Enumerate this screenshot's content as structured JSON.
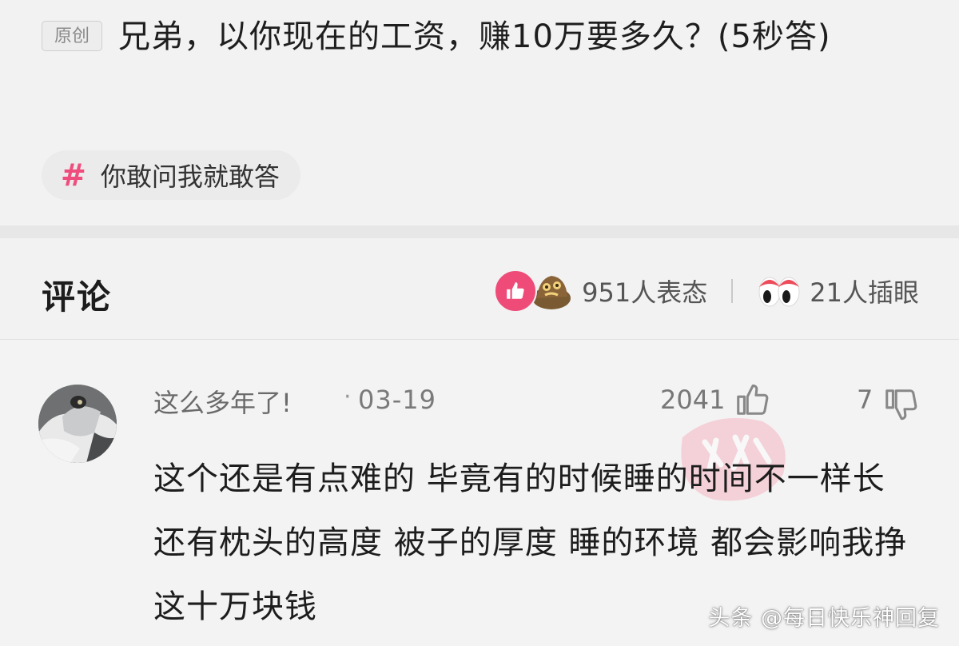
{
  "post": {
    "badge": "原创",
    "title": "兄弟，以你现在的工资，赚10万要多久？(5秒答)",
    "topic": "你敢问我就敢答"
  },
  "comments_header": {
    "title": "评论",
    "reactions_label": "951人表态",
    "eyes_label": "21人插眼"
  },
  "comment": {
    "username": "这么多年了!",
    "dot": "·",
    "date": "03-19",
    "likes": "2041",
    "dislikes": "7",
    "text": "这个还是有点难的 毕竟有的时候睡的时间不一样长 还有枕头的高度 被子的厚度 睡的环境 都会影响我挣这十万块钱"
  },
  "watermark": "头条 @每日快乐神回复",
  "colors": {
    "accent_pink": "#ee4b78",
    "background": "#f2f2f2",
    "text_primary": "#1e1e1e",
    "text_secondary": "#777777"
  },
  "icons": [
    "hash-icon",
    "like-reaction-icon",
    "dog-emoji-icon",
    "eyes-emoji-icon",
    "thumb-up-icon",
    "thumb-down-icon"
  ]
}
